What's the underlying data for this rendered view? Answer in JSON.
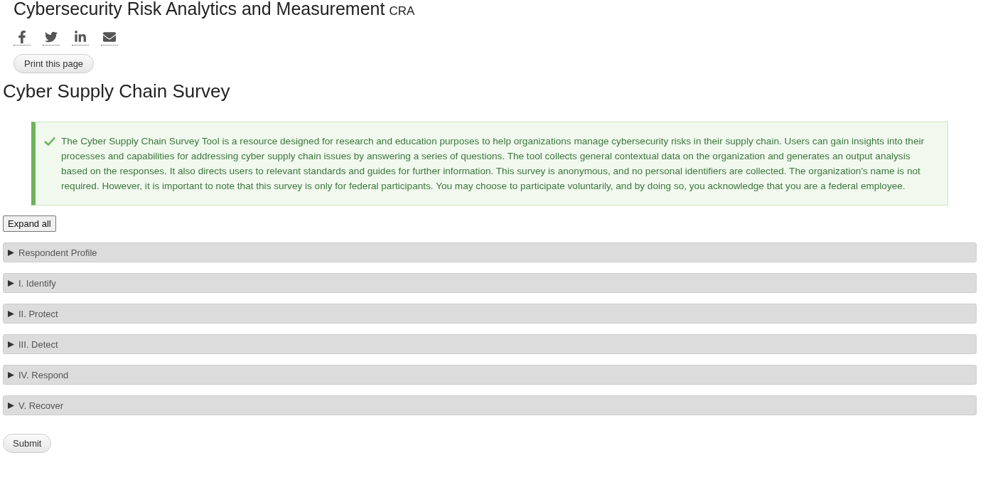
{
  "site": {
    "title": "Cybersecurity Risk Analytics and Measurement",
    "abbr": "CRA"
  },
  "share": [
    {
      "kind": "facebook"
    },
    {
      "kind": "twitter"
    },
    {
      "kind": "linkedin"
    },
    {
      "kind": "email"
    }
  ],
  "print_button": "Print this page",
  "heading": "Cyber Supply Chain Survey",
  "notice": "The Cyber Supply Chain Survey Tool is a resource designed for research and education purposes to help organizations manage cybersecurity risks in their supply chain. Users can gain insights into their processes and capabilities for addressing cyber supply chain issues by answering a series of questions. The tool collects general contextual data on the organization and generates an output analysis based on the responses. It also directs users to relevant standards and guides for further information. This survey is anonymous, and no personal identifiers are collected. The organization's name is not required. However, it is important to note that this survey is only for federal participants. You may choose to participate voluntarily, and by doing so, you acknowledge that you are a federal employee.",
  "expand_all": "Expand all",
  "sections": [
    {
      "label": "Respondent Profile",
      "expanded": false
    },
    {
      "label": "I. Identify",
      "expanded": false
    },
    {
      "label": "II. Protect",
      "expanded": false
    },
    {
      "label": "III. Detect",
      "expanded": false
    },
    {
      "label": "IV. Respond",
      "expanded": false
    },
    {
      "label": "V. Recover",
      "expanded": false
    }
  ],
  "submit": "Submit"
}
